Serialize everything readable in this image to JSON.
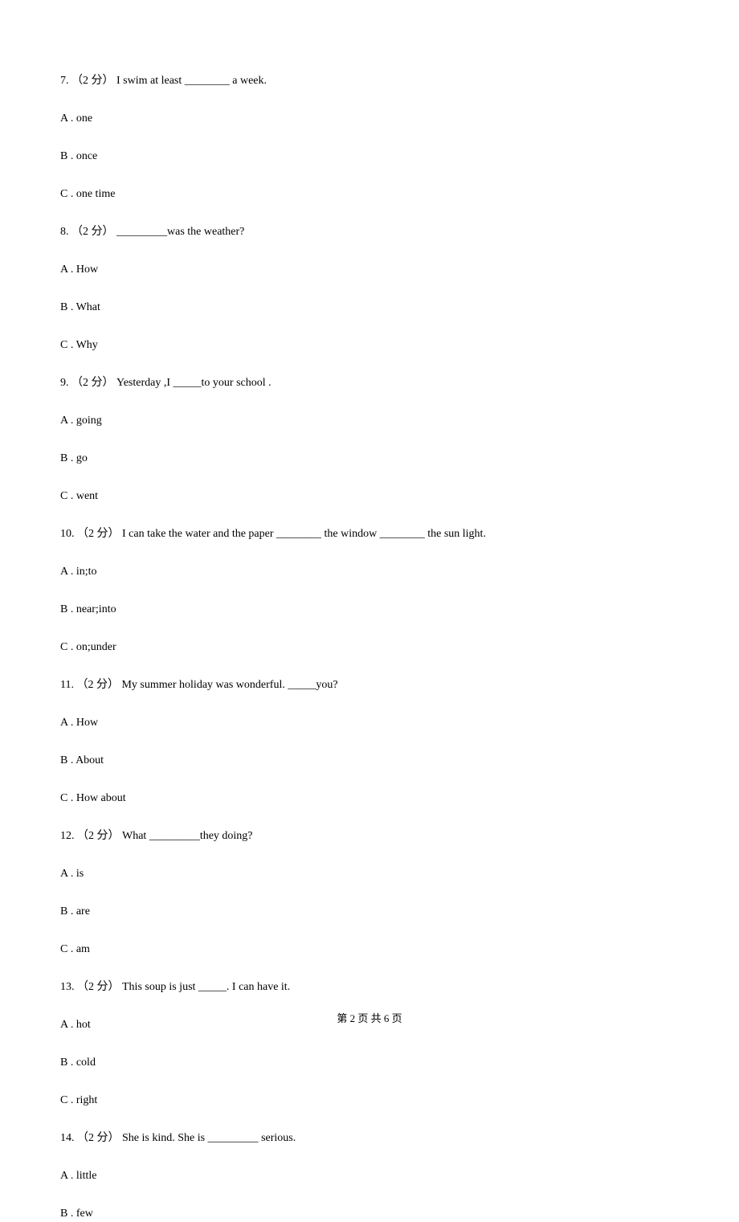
{
  "questions": [
    {
      "num": "7. ",
      "points": "（2 分）",
      "stem": " I swim at least ________ a week.",
      "choices": [
        "A . one",
        "B . once",
        "C . one time"
      ]
    },
    {
      "num": "8. ",
      "points": "（2 分）",
      "stem": " _________was the weather?",
      "choices": [
        "A . How",
        "B . What",
        "C . Why"
      ]
    },
    {
      "num": "9. ",
      "points": "（2 分）",
      "stem": " Yesterday ,I _____to your school .",
      "choices": [
        "A . going",
        "B . go",
        "C . went"
      ]
    },
    {
      "num": "10. ",
      "points": "（2 分）",
      "stem": " I can take the water and the paper ________ the window ________ the sun light.",
      "choices": [
        "A . in;to",
        "B . near;into",
        "C . on;under"
      ]
    },
    {
      "num": "11. ",
      "points": "（2 分）",
      "stem": " My summer holiday was wonderful. _____you?",
      "choices": [
        "A . How",
        "B . About",
        "C . How about"
      ]
    },
    {
      "num": "12. ",
      "points": "（2 分）",
      "stem": " What _________they doing?",
      "choices": [
        "A . is",
        "B . are",
        "C . am"
      ]
    },
    {
      "num": "13. ",
      "points": "（2 分）",
      "stem": " This soup is just _____. I can have it.",
      "choices": [
        "A . hot",
        "B . cold",
        "C . right"
      ]
    },
    {
      "num": "14. ",
      "points": "（2 分）",
      "stem": " She is kind. She is _________ serious.",
      "choices": [
        "A . little",
        "B . few"
      ]
    }
  ],
  "footer": "第 2 页 共 6 页"
}
